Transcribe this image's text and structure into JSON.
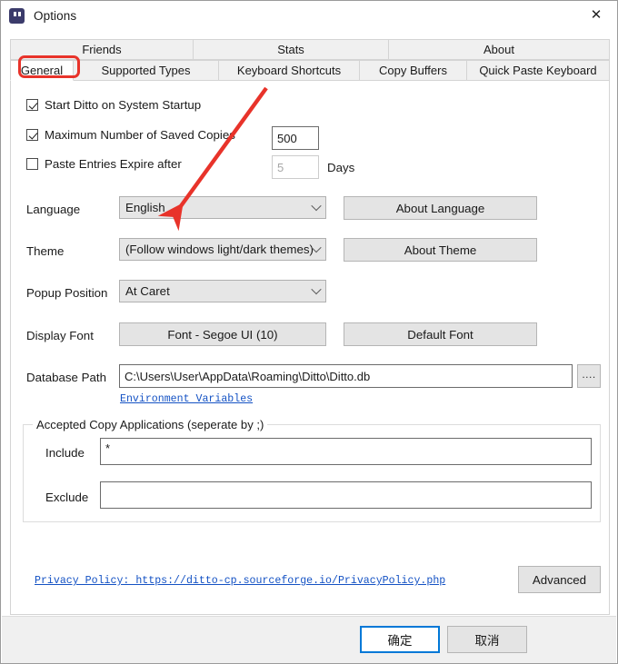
{
  "window": {
    "title": "Options",
    "icon": "ditto-app-icon",
    "close_label": "✕"
  },
  "tabs": {
    "row1": [
      {
        "label": "Friends",
        "selected": false
      },
      {
        "label": "Stats",
        "selected": false
      },
      {
        "label": "About",
        "selected": false
      }
    ],
    "row2": [
      {
        "label": "General",
        "selected": true
      },
      {
        "label": "Supported Types",
        "selected": false
      },
      {
        "label": "Keyboard Shortcuts",
        "selected": false
      },
      {
        "label": "Copy Buffers",
        "selected": false
      },
      {
        "label": "Quick Paste Keyboard",
        "selected": false
      }
    ]
  },
  "general": {
    "startup_checkbox": {
      "label": "Start Ditto on System Startup",
      "checked": true
    },
    "max_copies_checkbox": {
      "label": "Maximum Number of Saved Copies",
      "checked": true
    },
    "max_copies_value": "500",
    "expire_checkbox": {
      "label": "Paste Entries Expire after",
      "checked": false
    },
    "expire_value": "5",
    "expire_units": "Days",
    "language_label": "Language",
    "language_value": "English",
    "about_language_button": "About Language",
    "theme_label": "Theme",
    "theme_value": "(Follow windows light/dark themes)",
    "about_theme_button": "About Theme",
    "popup_position_label": "Popup Position",
    "popup_position_value": "At Caret",
    "display_font_label": "Display Font",
    "font_button": "Font - Segoe UI (10)",
    "default_font_button": "Default Font",
    "database_path_label": "Database Path",
    "database_path_value": "C:\\Users\\User\\AppData\\Roaming\\Ditto\\Ditto.db",
    "browse_button": "....",
    "environment_variables_link": "Environment Variables"
  },
  "accepted_copy_apps": {
    "title": "Accepted Copy Applications (seperate by ;)",
    "include_label": "Include",
    "include_value": "*",
    "exclude_label": "Exclude",
    "exclude_value": ""
  },
  "bottom": {
    "privacy_link": "Privacy Policy: https://ditto-cp.sourceforge.io/PrivacyPolicy.php",
    "advanced_button": "Advanced"
  },
  "footer": {
    "ok_button": "确定",
    "cancel_button": "取消"
  },
  "annotations": {
    "highlight_color": "#e8332a",
    "arrow_color": "#e8332a",
    "highlight_target": "General tab",
    "arrow_target": "Language dropdown"
  }
}
